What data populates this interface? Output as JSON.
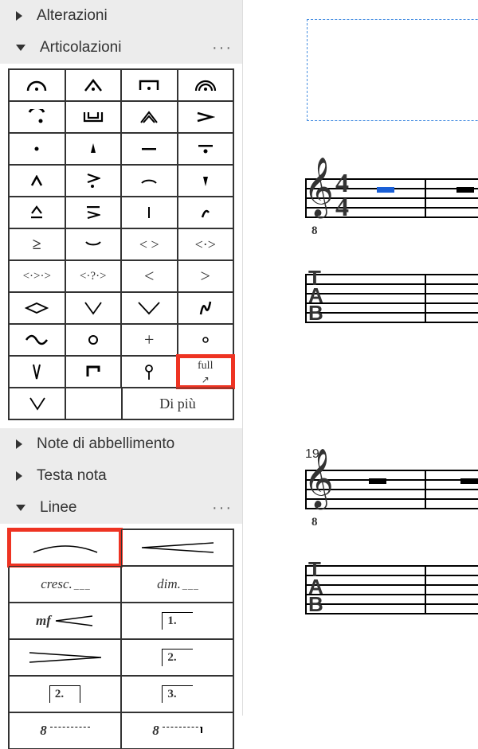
{
  "sections": {
    "alterazioni": "Alterazioni",
    "articolazioni": "Articolazioni",
    "note_abbellimento": "Note di abbellimento",
    "testa_nota": "Testa nota",
    "linee": "Linee"
  },
  "articulations": {
    "more_label": "Di più",
    "full_label": "full",
    "grid": [
      [
        "fermata",
        "short-fermata",
        "long-fermata",
        "very-long-fermata"
      ],
      [
        "fermata-below",
        "long-fermata-below",
        "double-chevron",
        "accent"
      ],
      [
        "staccato",
        "staccatissimo-wedge",
        "tenuto",
        "portato"
      ],
      [
        "marcato",
        "marcato-staccato",
        "soft-accent",
        "staccatissimo"
      ],
      [
        "marcato-tenuto",
        "tenuto-accent",
        "staccatissimo-stroke",
        "stress"
      ],
      [
        "greater-equal",
        "smile",
        "diamond-open",
        "diamond-dot"
      ],
      [
        "double-diamond",
        "diamond-angle",
        "less-than",
        "greater-than"
      ],
      [
        "diamond-large",
        "down-v",
        "down-v-wide",
        "sine-small"
      ],
      [
        "sine",
        "circle-open",
        "plus",
        "circle-small"
      ],
      [
        "down-stroke",
        "bracket-shape",
        "circle-stem",
        "bend-full"
      ],
      [
        "down-v-plain",
        "",
        "more",
        ""
      ]
    ]
  },
  "lines": {
    "rows": [
      [
        "slur",
        "crescendo-hairpin"
      ],
      [
        "cresc-text",
        "dim-text"
      ],
      [
        "mf-cresc",
        "volta-1"
      ],
      [
        "decrescendo-hairpin",
        "volta-2"
      ],
      [
        "volta-2-closed",
        "volta-3"
      ],
      [
        "ottava-8",
        "ottava-8-down"
      ]
    ],
    "labels": {
      "cresc": "cresc.",
      "dim": "dim.",
      "mf": "mf",
      "v1": "1.",
      "v2": "2.",
      "v3": "3.",
      "ottava": "8"
    }
  },
  "score": {
    "measure_number": "19",
    "clef_8": "8",
    "timesig_top": "4",
    "timesig_bot": "4",
    "tab": [
      "T",
      "A",
      "B"
    ]
  },
  "highlights": [
    "bend-full",
    "slur"
  ]
}
